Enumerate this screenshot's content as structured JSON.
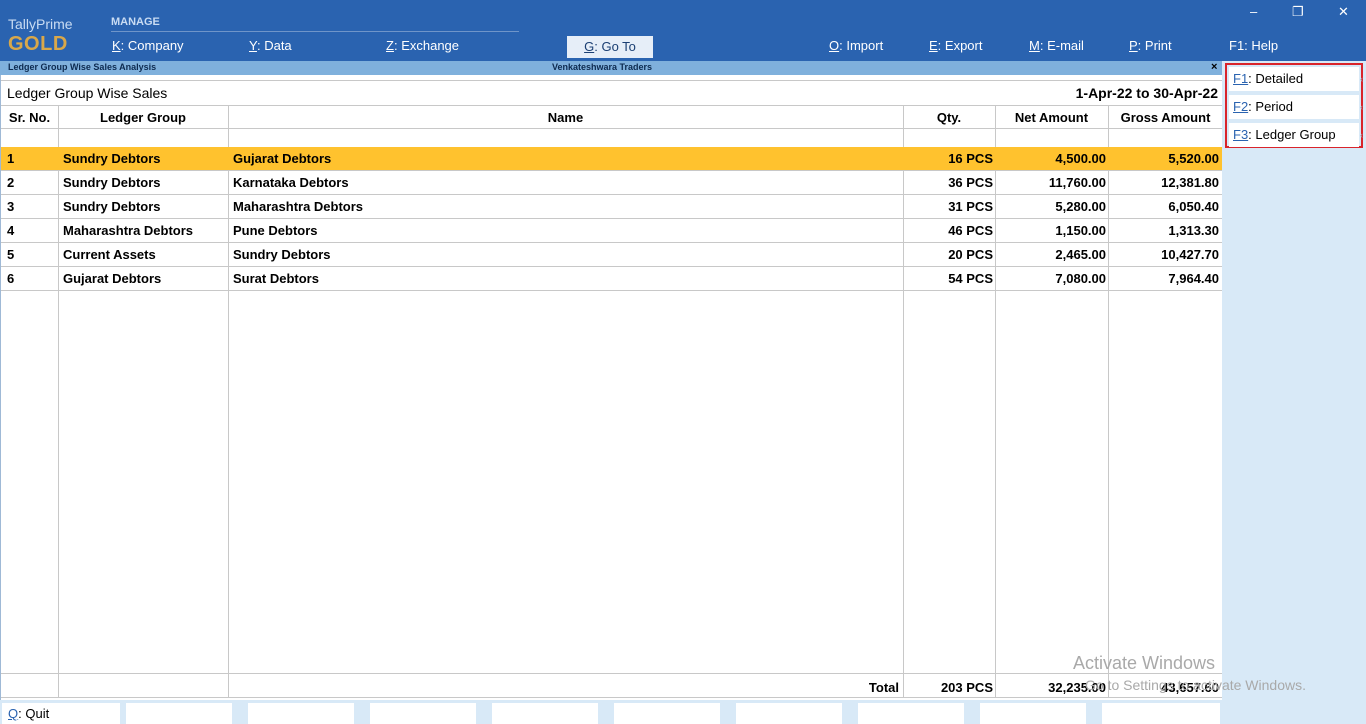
{
  "app": {
    "brand_top": "TallyPrime",
    "brand_edition": "GOLD",
    "section_label": "MANAGE"
  },
  "menu": {
    "company": {
      "key": "K",
      "label": "Company"
    },
    "data": {
      "key": "Y",
      "label": "Data"
    },
    "exchange": {
      "key": "Z",
      "label": "Exchange"
    },
    "goto": {
      "key": "G",
      "label": "Go To"
    },
    "import": {
      "key": "O",
      "label": "Import"
    },
    "export": {
      "key": "E",
      "label": "Export"
    },
    "email": {
      "key": "M",
      "label": "E-mail"
    },
    "print": {
      "key": "P",
      "label": "Print"
    },
    "help": {
      "key": "F1",
      "label": "Help"
    }
  },
  "window_controls": {
    "minimize": "–",
    "restore": "❐",
    "close": "✕"
  },
  "titlebar": {
    "report_name": "Ledger Group Wise Sales Analysis",
    "company": "Venkateshwara Traders",
    "close": "×"
  },
  "report": {
    "title": "Ledger Group Wise Sales",
    "period": "1-Apr-22 to 30-Apr-22",
    "columns": {
      "sr": "Sr. No.",
      "group": "Ledger Group",
      "name": "Name",
      "qty": "Qty.",
      "net": "Net Amount",
      "gross": "Gross Amount"
    },
    "rows": [
      {
        "sr": "1",
        "group": "Sundry Debtors",
        "name": "Gujarat Debtors",
        "qty": "16 PCS",
        "net": "4,500.00",
        "gross": "5,520.00"
      },
      {
        "sr": "2",
        "group": "Sundry Debtors",
        "name": "Karnataka Debtors",
        "qty": "36 PCS",
        "net": "11,760.00",
        "gross": "12,381.80"
      },
      {
        "sr": "3",
        "group": "Sundry Debtors",
        "name": "Maharashtra Debtors",
        "qty": "31 PCS",
        "net": "5,280.00",
        "gross": "6,050.40"
      },
      {
        "sr": "4",
        "group": "Maharashtra Debtors",
        "name": "Pune Debtors",
        "qty": "46 PCS",
        "net": "1,150.00",
        "gross": "1,313.30"
      },
      {
        "sr": "5",
        "group": "Current Assets",
        "name": "Sundry Debtors",
        "qty": "20 PCS",
        "net": "2,465.00",
        "gross": "10,427.70"
      },
      {
        "sr": "6",
        "group": "Gujarat Debtors",
        "name": "Surat Debtors",
        "qty": "54 PCS",
        "net": "7,080.00",
        "gross": "7,964.40"
      }
    ],
    "total": {
      "label": "Total",
      "qty": "203 PCS",
      "net": "32,235.00",
      "gross": "43,657.60"
    }
  },
  "side_buttons": [
    {
      "key": "F1",
      "label": "Detailed"
    },
    {
      "key": "F2",
      "label": "Period"
    },
    {
      "key": "F3",
      "label": "Ledger Group"
    }
  ],
  "bottom": {
    "quit": {
      "key": "Q",
      "label": "Quit"
    }
  },
  "watermark": {
    "line1": "Activate Windows",
    "line2": "Go to Settings to activate Windows."
  },
  "colors": {
    "topbar": "#2a63b0",
    "selected_row": "#ffc22e",
    "highlight_border": "#d9242b",
    "brand_gold": "#d9a84a"
  }
}
